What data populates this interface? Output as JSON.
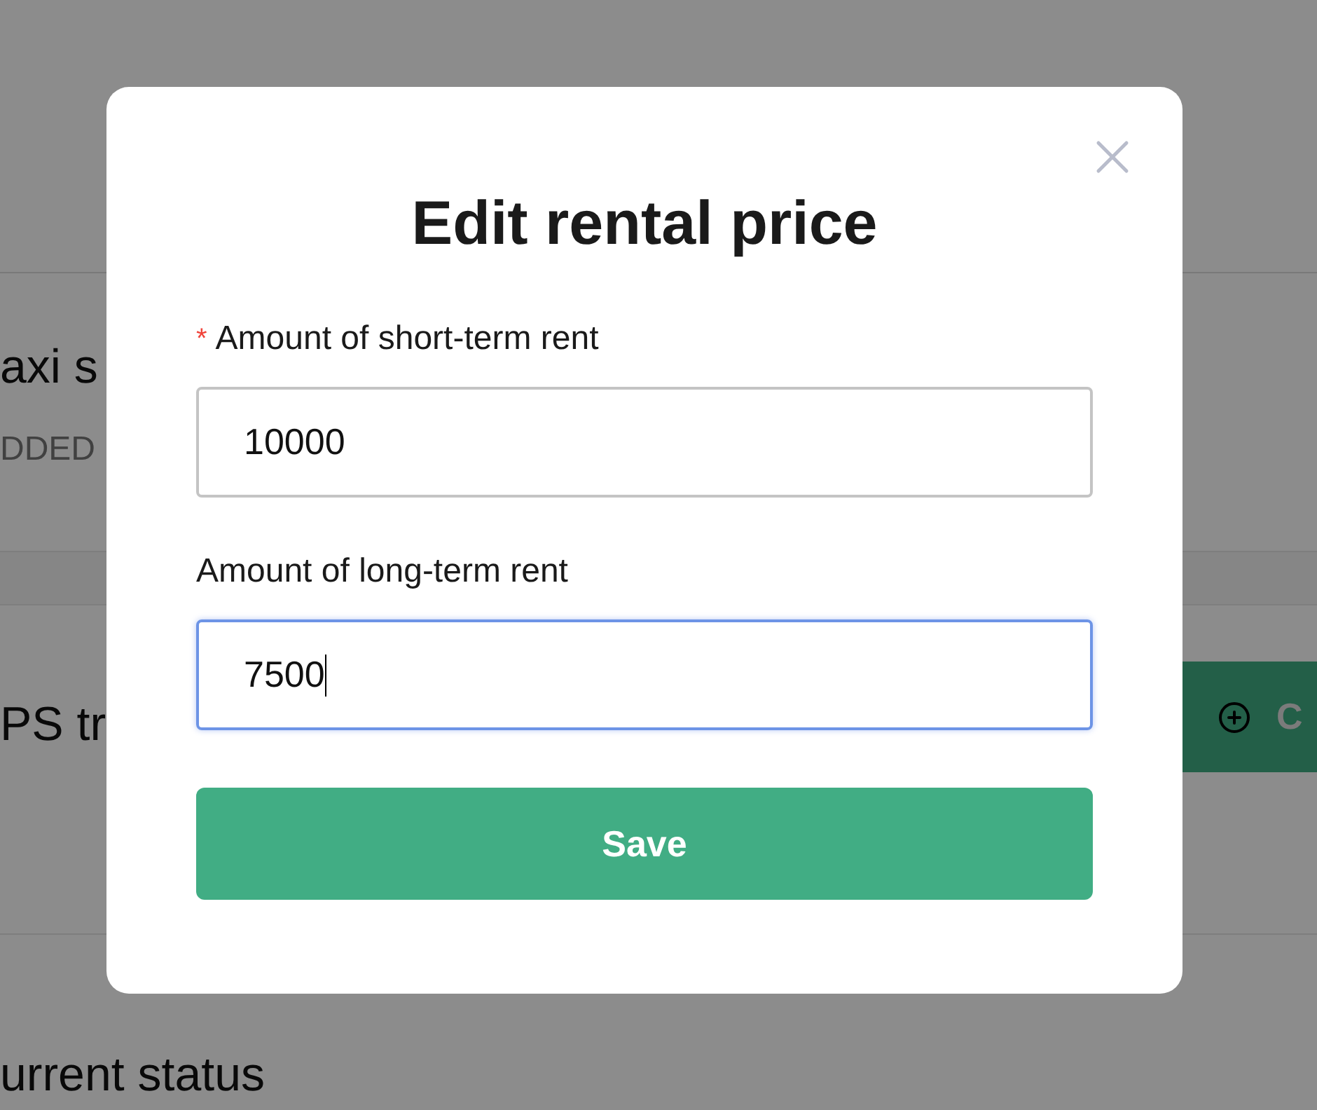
{
  "background": {
    "sections": [
      {
        "title": "axi s",
        "subtitle": "DDED"
      },
      {
        "title": "PS tr",
        "button": "C"
      },
      {
        "title": "urrent status"
      }
    ]
  },
  "dialog": {
    "title": "Edit rental price",
    "fields": [
      {
        "label": "Amount of short-term rent",
        "required_mark": "*",
        "value": "10000",
        "focused": false
      },
      {
        "label": "Amount of long-term rent",
        "value": "7500",
        "focused": true
      }
    ],
    "submit": "Save"
  }
}
